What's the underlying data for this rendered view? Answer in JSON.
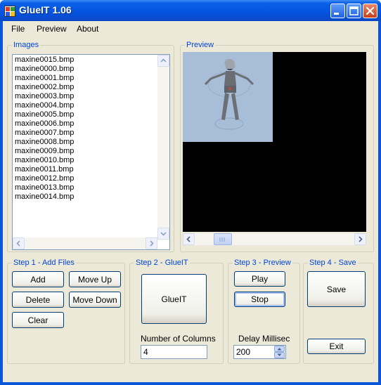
{
  "window": {
    "title": "GlueIT 1.06"
  },
  "menu": {
    "items": [
      "File",
      "Preview",
      "About"
    ]
  },
  "images": {
    "title": "Images",
    "files": [
      "maxine0015.bmp",
      "maxine0000.bmp",
      "maxine0001.bmp",
      "maxine0002.bmp",
      "maxine0003.bmp",
      "maxine0004.bmp",
      "maxine0005.bmp",
      "maxine0006.bmp",
      "maxine0007.bmp",
      "maxine0008.bmp",
      "maxine0009.bmp",
      "maxine0010.bmp",
      "maxine0011.bmp",
      "maxine0012.bmp",
      "maxine0013.bmp",
      "maxine0014.bmp"
    ]
  },
  "preview": {
    "title": "Preview"
  },
  "step1": {
    "title": "Step 1 - Add Files",
    "add": "Add",
    "move_up": "Move Up",
    "delete": "Delete",
    "move_down": "Move Down",
    "clear": "Clear"
  },
  "step2": {
    "title": "Step 2 - GlueIT",
    "glue": "GlueIT",
    "columns_label": "Number of Columns",
    "columns_value": "4"
  },
  "step3": {
    "title": "Step 3 - Preview",
    "play": "Play",
    "stop": "Stop",
    "delay_label": "Delay Millisec",
    "delay_value": "200"
  },
  "step4": {
    "title": "Step 4 - Save",
    "save": "Save",
    "exit": "Exit"
  },
  "colors": {
    "titlebar": "#0554e0",
    "dialog": "#ece9d8",
    "group_title": "#0046d5",
    "preview_bg": "#000000",
    "sprite_bg": "#a7bdd8"
  }
}
